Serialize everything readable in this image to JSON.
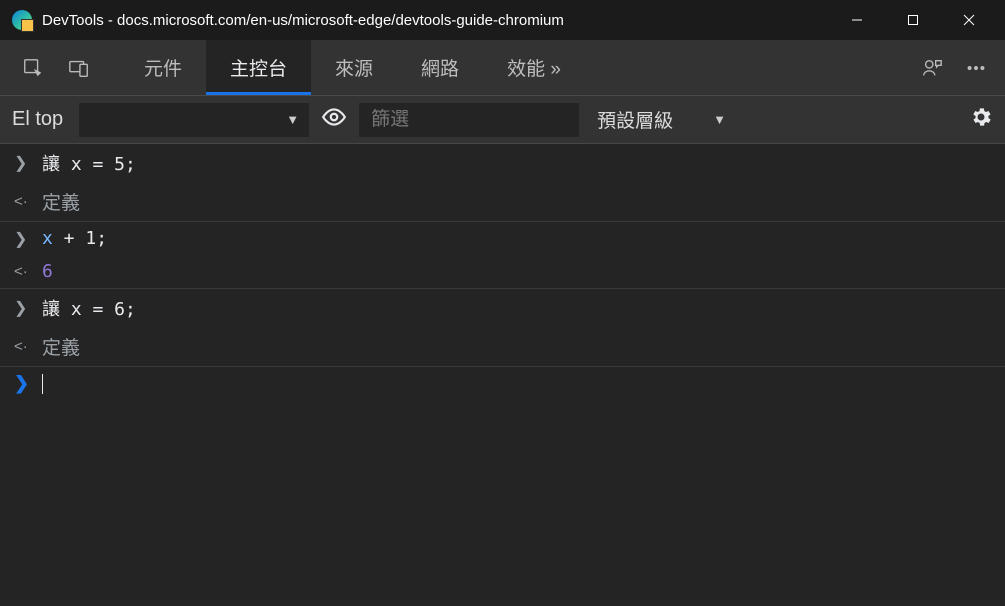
{
  "window": {
    "title": "DevTools - docs.microsoft.com/en-us/microsoft-edge/devtools-guide-chromium"
  },
  "tabs": {
    "elements": "元件",
    "console": "主控台",
    "sources": "來源",
    "network": "網路",
    "performance": "效能 »"
  },
  "controlbar": {
    "context_label": "El top",
    "filter_placeholder": "篩選",
    "level_label": "預設層級"
  },
  "console_rows": {
    "r1_input": "讓 x = 5;",
    "r1_output": "定義",
    "r2_input_var": "x",
    "r2_input_rest": " + 1;",
    "r2_output": "6",
    "r3_input": "讓 x = 6;",
    "r3_output": "定義"
  }
}
